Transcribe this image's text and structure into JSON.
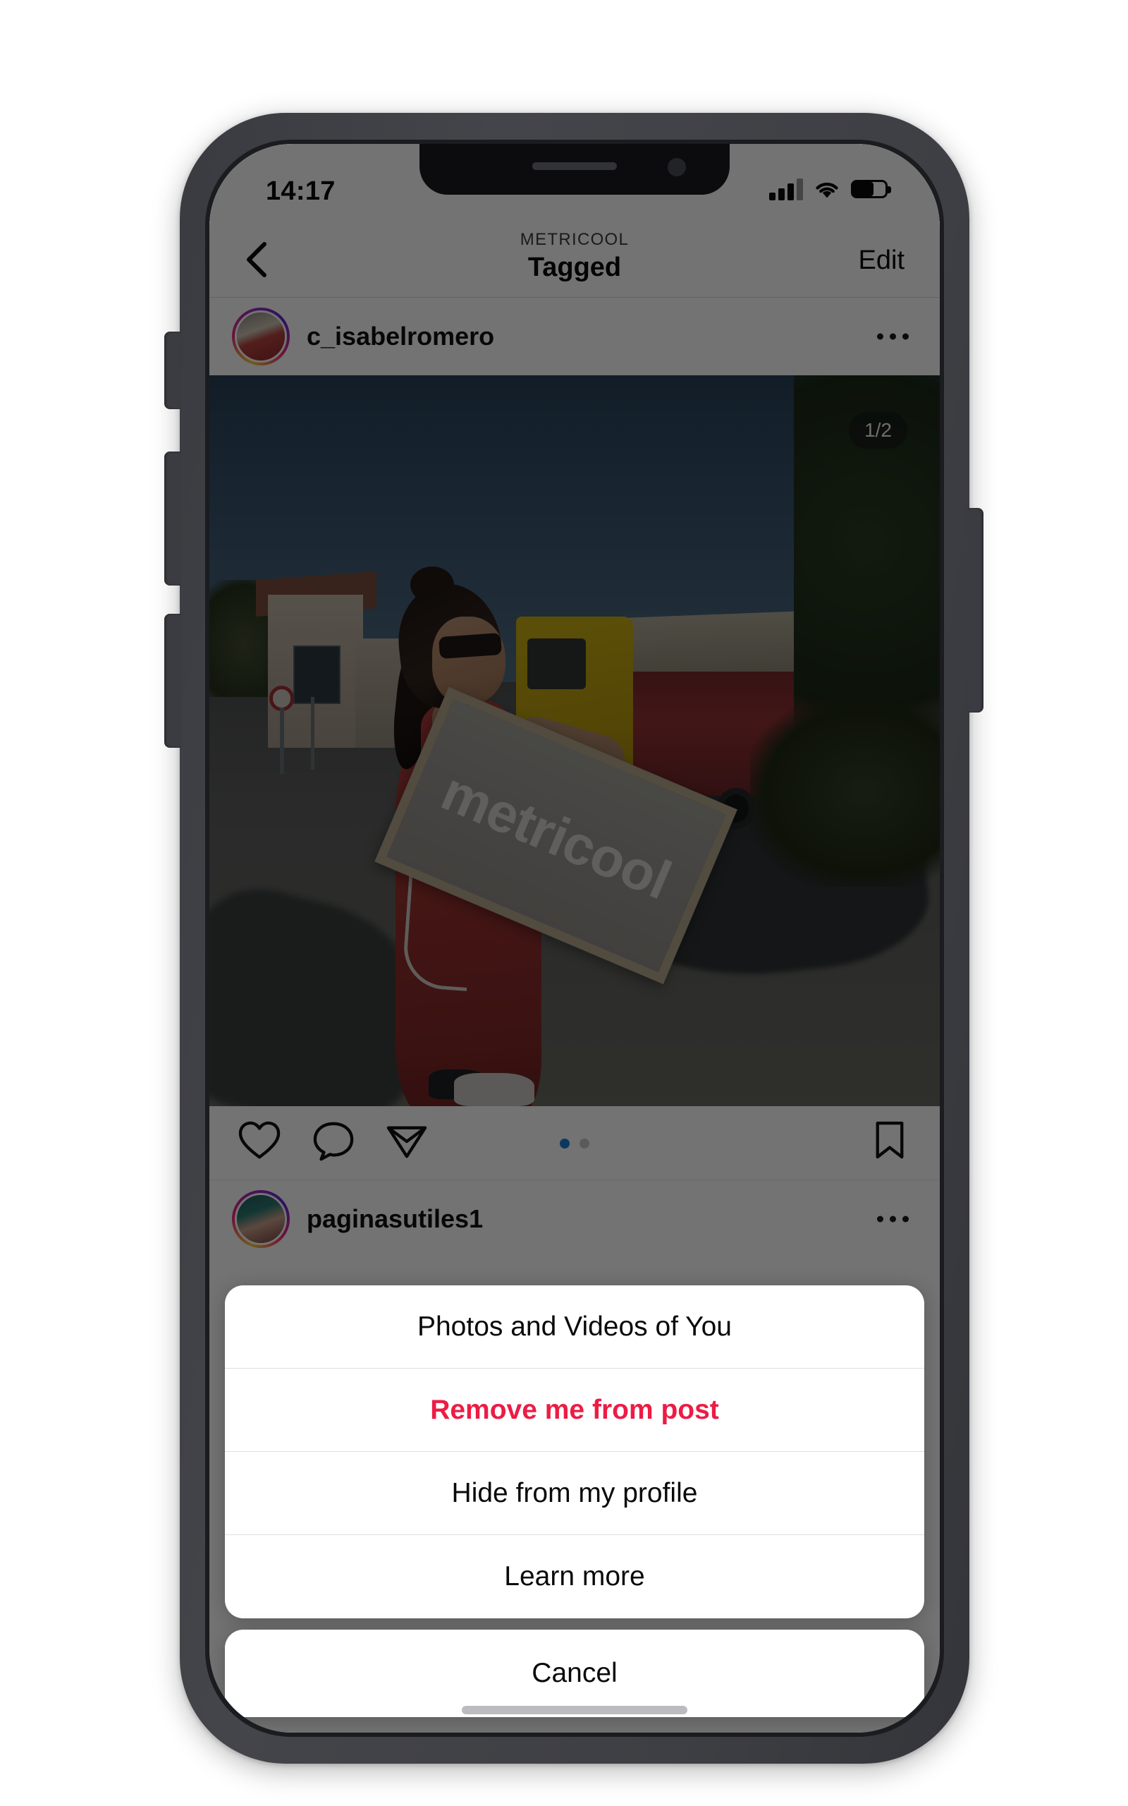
{
  "status_bar": {
    "time": "14:17",
    "signal_icon": "cellular-signal-icon",
    "wifi_icon": "wifi-icon",
    "battery_icon": "battery-icon",
    "battery_level_pct": 62
  },
  "nav_bar": {
    "back_icon": "back-chevron-icon",
    "eyebrow": "METRICOOL",
    "title": "Tagged",
    "edit_label": "Edit"
  },
  "post": {
    "username": "c_isabelromero",
    "more_icon": "more-options-icon",
    "carousel_indicator": "1/2",
    "image_sign_text": "metricool",
    "actions": {
      "like_icon": "heart-icon",
      "comment_icon": "comment-bubble-icon",
      "share_icon": "send-paper-plane-icon",
      "save_icon": "bookmark-icon",
      "page_dots_total": 2,
      "page_dots_active": 1
    }
  },
  "next_post": {
    "username": "paginasutiles1",
    "more_icon": "more-options-icon"
  },
  "action_sheet": {
    "title": "Photos and Videos of You",
    "items": [
      {
        "label": "Remove me from post",
        "style": "destructive"
      },
      {
        "label": "Hide from my profile",
        "style": "default"
      },
      {
        "label": "Learn more",
        "style": "default"
      }
    ],
    "cancel_label": "Cancel"
  },
  "colors": {
    "destructive": "#ec1c45",
    "sheet_background": "#ffffff",
    "scrim": "rgba(0,0,0,0.55)",
    "accent_dot": "#1e7fd4",
    "device_frame": "#3e3f44",
    "page_background": "#ffffff"
  },
  "home_indicator": "home-indicator"
}
